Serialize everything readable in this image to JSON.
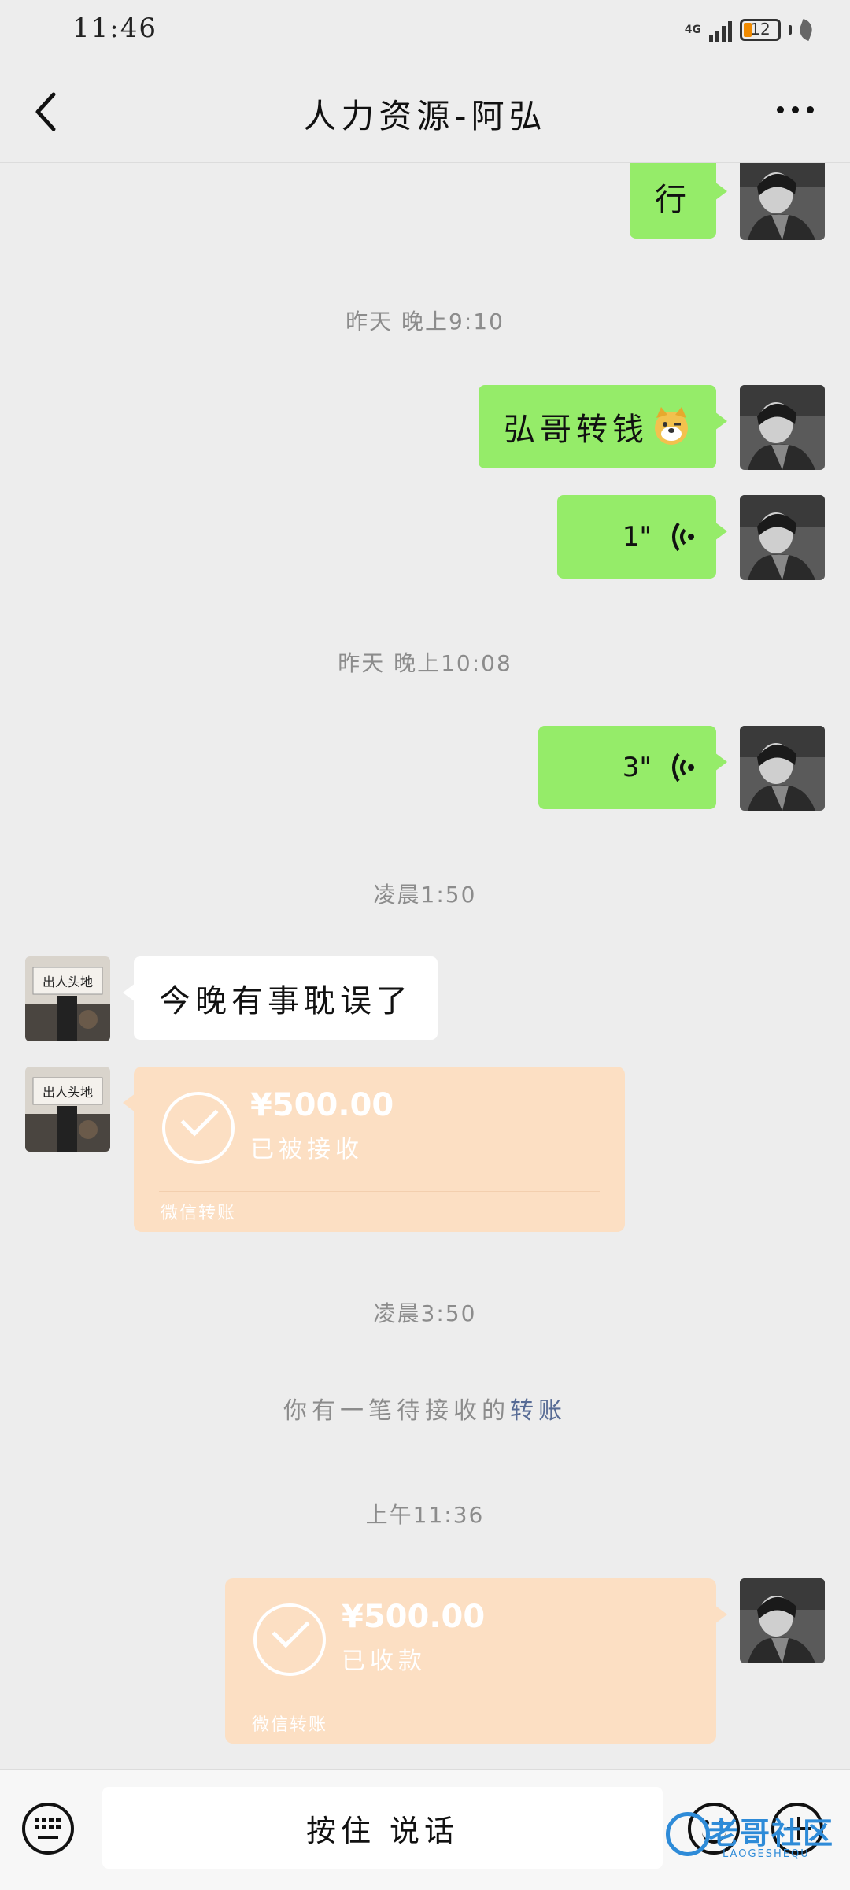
{
  "status_bar": {
    "time": "11:46",
    "network": "4G",
    "battery": "12"
  },
  "header": {
    "title": "人力资源-阿弘"
  },
  "messages": {
    "m1_text": "行",
    "ts1": "昨天 晚上9:10",
    "m2_text": "弘哥转钱",
    "m3_duration": "1\"",
    "ts2": "昨天 晚上10:08",
    "m4_duration": "3\"",
    "ts3": "凌晨1:50",
    "m5_text": "今晚有事耽误了",
    "transfer1": {
      "amount": "¥500.00",
      "status": "已被接收",
      "footer": "微信转账"
    },
    "ts4": "凌晨3:50",
    "system_notice": {
      "prefix": "你有一笔待接收的",
      "link": "转账"
    },
    "ts5": "上午11:36",
    "transfer2": {
      "amount": "¥500.00",
      "status": "已收款",
      "footer": "微信转账"
    }
  },
  "input_bar": {
    "hold_to_talk": "按住 说话"
  },
  "watermark": {
    "text": "老哥社区",
    "sub": "LAOGESHEQU"
  },
  "colors": {
    "bubble_green": "#95ec69",
    "transfer_bg": "#fcdfc3",
    "link": "#576b95",
    "background": "#ededed"
  },
  "icons": [
    "back-arrow-icon",
    "more-dots-icon",
    "voice-wave-icon",
    "check-circle-icon",
    "keyboard-icon",
    "emoji-icon",
    "plus-icon",
    "doge-emoji-icon"
  ]
}
